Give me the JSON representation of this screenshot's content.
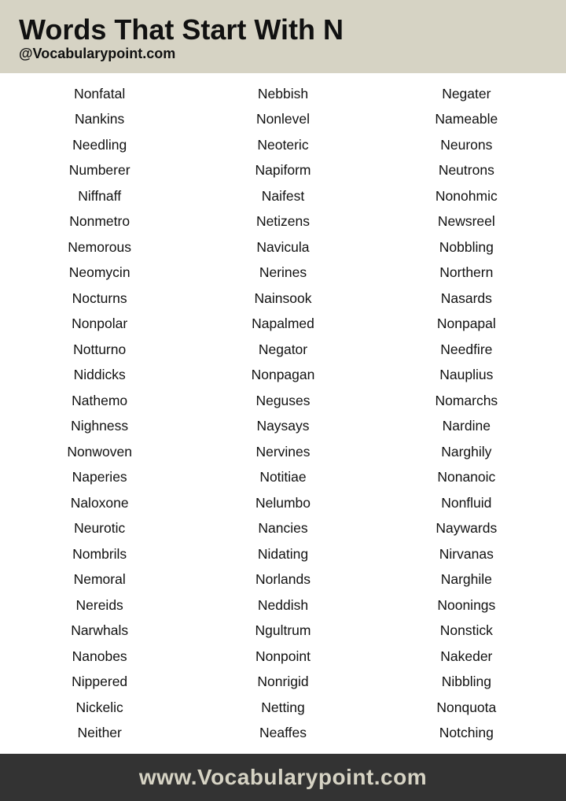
{
  "header": {
    "title": "Words That Start With N",
    "subtitle": "@Vocabularypoint.com"
  },
  "footer": {
    "text": "www.Vocabularypoint.com"
  },
  "words": [
    [
      "Nonfatal",
      "Nebbish",
      "Negater"
    ],
    [
      "Nankins",
      "Nonlevel",
      "Nameable"
    ],
    [
      "Needling",
      "Neoteric",
      "Neurons"
    ],
    [
      "Numberer",
      "Napiform",
      "Neutrons"
    ],
    [
      "Niffnaff",
      "Naifest",
      "Nonohmic"
    ],
    [
      "Nonmetro",
      "Netizens",
      "Newsreel"
    ],
    [
      "Nemorous",
      "Navicula",
      "Nobbling"
    ],
    [
      "Neomycin",
      "Nerines",
      "Northern"
    ],
    [
      "Nocturns",
      "Nainsook",
      "Nasards"
    ],
    [
      "Nonpolar",
      "Napalmed",
      "Nonpapal"
    ],
    [
      "Notturno",
      "Negator",
      "Needfire"
    ],
    [
      "Niddicks",
      "Nonpagan",
      "Nauplius"
    ],
    [
      "Nathemo",
      "Neguses",
      "Nomarchs"
    ],
    [
      "Nighness",
      "Naysays",
      "Nardine"
    ],
    [
      "Nonwoven",
      "Nervines",
      "Narghily"
    ],
    [
      "Naperies",
      "Notitiae",
      "Nonanoic"
    ],
    [
      "Naloxone",
      "Nelumbo",
      "Nonfluid"
    ],
    [
      "Neurotic",
      "Nancies",
      "Naywards"
    ],
    [
      "Nombrils",
      "Nidating",
      "Nirvanas"
    ],
    [
      "Nemoral",
      "Norlands",
      "Narghile"
    ],
    [
      "Nereids",
      "Neddish",
      "Noonings"
    ],
    [
      "Narwhals",
      "Ngultrum",
      "Nonstick"
    ],
    [
      "Nanobes",
      "Nonpoint",
      "Nakeder"
    ],
    [
      "Nippered",
      "Nonrigid",
      "Nibbling"
    ],
    [
      "Nickelic",
      "Netting",
      "Nonquota"
    ],
    [
      "Neither",
      "Neaffes",
      "Notching"
    ]
  ]
}
